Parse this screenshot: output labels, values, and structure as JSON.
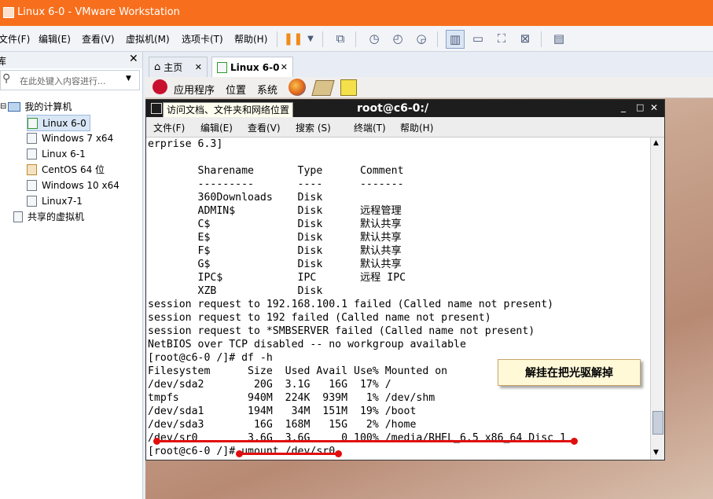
{
  "window": {
    "title": "Linux 6-0 - VMware Workstation"
  },
  "menubar": {
    "items": [
      "文件(F)",
      "编辑(E)",
      "查看(V)",
      "虚拟机(M)",
      "选项卡(T)",
      "帮助(H)"
    ]
  },
  "library": {
    "header": "库",
    "search_placeholder": "在此处键入内容进行...",
    "root": "我的计算机",
    "vms": [
      "Linux 6-0",
      "Windows 7 x64",
      "Linux 6-1",
      "CentOS 64 位",
      "Windows 10 x64",
      "Linux7-1"
    ],
    "shared": "共享的虚拟机"
  },
  "tabs": [
    {
      "label": "主页",
      "active": false
    },
    {
      "label": "Linux 6-0",
      "active": true
    }
  ],
  "guest_panel": {
    "apps": "应用程序",
    "places": "位置",
    "system": "系统",
    "tooltip": "访问文档、文件夹和网络位置"
  },
  "terminal": {
    "title": "root@c6-0:/",
    "menu": [
      "文件(F)",
      "编辑(E)",
      "查看(V)",
      "搜索 (S)",
      "终端(T)",
      "帮助(H)"
    ],
    "lines": [
      "erprise 6.3]",
      "",
      "        Sharename       Type      Comment",
      "        ---------       ----      -------",
      "        360Downloads    Disk",
      "        ADMIN$          Disk      远程管理",
      "        C$              Disk      默认共享",
      "        E$              Disk      默认共享",
      "        F$              Disk      默认共享",
      "        G$              Disk      默认共享",
      "        IPC$            IPC       远程 IPC",
      "        XZB             Disk",
      "session request to 192.168.100.1 failed (Called name not present)",
      "session request to 192 failed (Called name not present)",
      "session request to *SMBSERVER failed (Called name not present)",
      "NetBIOS over TCP disabled -- no workgroup available",
      "[root@c6-0 /]# df -h",
      "Filesystem      Size  Used Avail Use% Mounted on",
      "/dev/sda2        20G  3.1G   16G  17% /",
      "tmpfs           940M  224K  939M   1% /dev/shm",
      "/dev/sda1       194M   34M  151M  19% /boot",
      "/dev/sda3        16G  168M   15G   2% /home",
      "/dev/sr0        3.6G  3.6G     0 100% /media/RHEL_6.5 x86_64 Disc 1",
      "[root@c6-0 /]# umount /dev/sr0"
    ]
  },
  "annotation": {
    "text": "解挂在把光驱解掉"
  },
  "colors": {
    "titlebar": "#f76f1c",
    "annotation_red": "#e10e0e",
    "annotation_bg": "#fff9d8"
  }
}
